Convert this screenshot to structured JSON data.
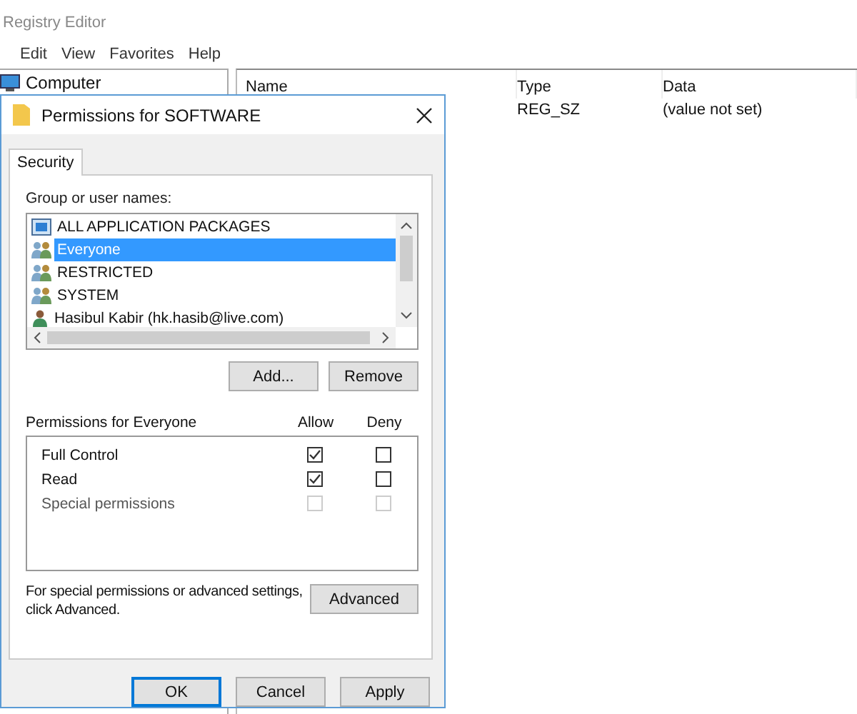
{
  "app": {
    "title": "Registry Editor",
    "menu": [
      "Edit",
      "View",
      "Favorites",
      "Help"
    ],
    "tree": [
      {
        "label": "Computer"
      }
    ],
    "columns": [
      "Name",
      "Type",
      "Data"
    ],
    "rows": [
      {
        "type": "REG_SZ",
        "data": "(value not set)"
      }
    ]
  },
  "dialog": {
    "title": "Permissions for SOFTWARE",
    "tabs": [
      {
        "label": "Security",
        "selected": true
      }
    ],
    "group_label": "Group or user names:",
    "users": [
      {
        "name": "ALL APPLICATION PACKAGES",
        "kind": "package",
        "selected": false
      },
      {
        "name": "Everyone",
        "kind": "group",
        "selected": true
      },
      {
        "name": "RESTRICTED",
        "kind": "group",
        "selected": false
      },
      {
        "name": "SYSTEM",
        "kind": "group",
        "selected": false
      },
      {
        "name": "Hasibul Kabir (hk.hasib@live.com)",
        "kind": "user",
        "selected": false
      }
    ],
    "user_buttons": [
      "Add...",
      "Remove"
    ],
    "permissions_label": "Permissions for Everyone",
    "allow_header": "Allow",
    "deny_header": "Deny",
    "permissions": [
      {
        "name": "Full Control",
        "allow": true,
        "deny": false,
        "disabled": false
      },
      {
        "name": "Read",
        "allow": true,
        "deny": false,
        "disabled": false
      },
      {
        "name": "Special permissions",
        "allow": false,
        "deny": false,
        "disabled": true
      }
    ],
    "advanced_note": "For special permissions or advanced settings, click Advanced.",
    "advanced_button": "Advanced",
    "footer_buttons": [
      {
        "label": "OK",
        "default": true
      },
      {
        "label": "Cancel",
        "default": false
      },
      {
        "label": "Apply",
        "default": false
      }
    ]
  }
}
